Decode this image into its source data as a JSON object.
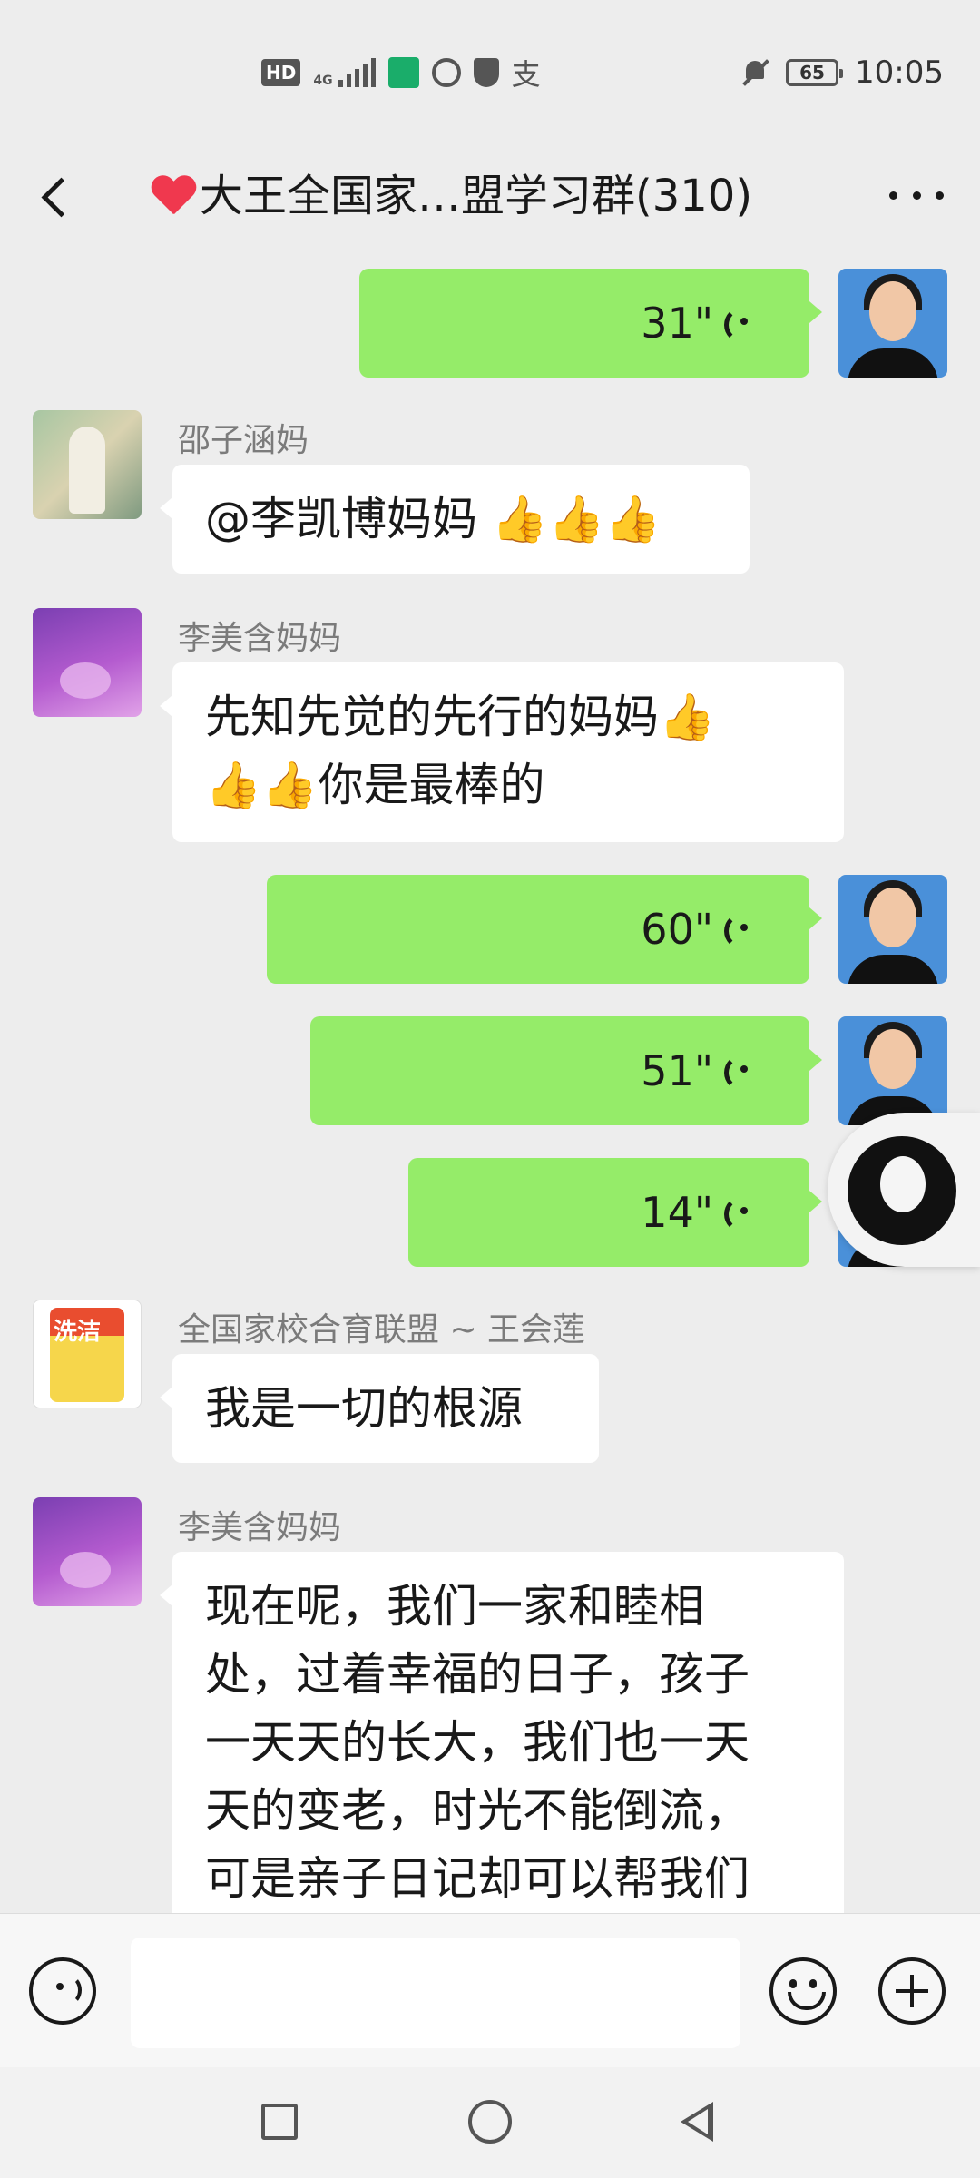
{
  "status_bar": {
    "hd": "HD",
    "network": "4G",
    "battery": "65",
    "time": "10:05",
    "icons": [
      "signal-icon",
      "shield-app-icon",
      "globe-icon",
      "vpn-shield-icon",
      "alipay-icon",
      "mute-bell-icon",
      "battery-icon"
    ]
  },
  "header": {
    "title": "大王全国家…盟学习群(310)",
    "back_icon": "back-arrow-icon",
    "more_icon": "more-icon"
  },
  "messages": [
    {
      "type": "voice",
      "side": "out",
      "duration": "31\""
    },
    {
      "type": "text",
      "side": "in",
      "sender": "邵子涵妈",
      "text": "@李凯博妈妈 👍👍👍"
    },
    {
      "type": "text",
      "side": "in",
      "sender": "李美含妈妈",
      "lines": [
        "先知先觉的先行的妈妈👍",
        "👍👍你是最棒的"
      ]
    },
    {
      "type": "voice",
      "side": "out",
      "duration": "60\""
    },
    {
      "type": "voice",
      "side": "out",
      "duration": "51\""
    },
    {
      "type": "voice",
      "side": "out",
      "duration": "14\""
    },
    {
      "type": "text",
      "side": "in",
      "sender": "全国家校合育联盟 ~ 王会莲",
      "text": "我是一切的根源"
    },
    {
      "type": "text",
      "side": "in",
      "sender": "李美含妈妈",
      "lines": [
        "现在呢，我们一家和睦相",
        "处，过着幸福的日子，孩子",
        "一天天的长大，我们也一天",
        "天的变老，时光不能倒流，",
        "可是亲子日记却可以帮我们"
      ]
    }
  ],
  "avatar_brand": "洗洁",
  "colors": {
    "outgoing_bubble": "#95ec69",
    "incoming_bubble": "#ffffff",
    "background": "#ededed",
    "heart": "#f0384e"
  }
}
